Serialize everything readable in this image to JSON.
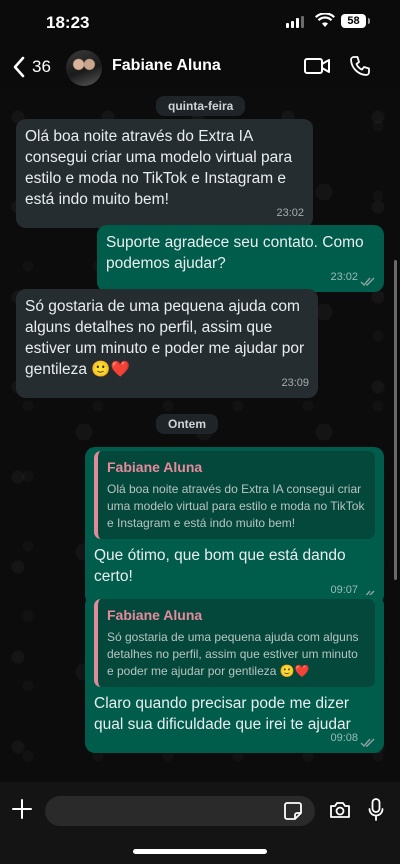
{
  "status_bar": {
    "time": "18:23",
    "battery": "58"
  },
  "header": {
    "back_count": "36",
    "contact_name": "Fabiane Aluna"
  },
  "day_separators": [
    "quinta-feira",
    "Ontem"
  ],
  "messages": [
    {
      "direction": "in",
      "text": "Olá boa noite através do Extra IA consegui criar uma modelo virtual para estilo e moda no TikTok e Instagram e está indo muito bem!",
      "time": "23:02"
    },
    {
      "direction": "out",
      "text": "Suporte agradece seu contato. Como podemos ajudar?",
      "time": "23:02"
    },
    {
      "direction": "in",
      "text": "Só gostaria de uma pequena ajuda com alguns detalhes no perfil, assim que estiver um minuto e poder me ajudar por gentileza 🙂❤️",
      "time": "23:09"
    },
    {
      "direction": "out",
      "quote_name": "Fabiane Aluna",
      "quote_text": "Olá boa noite através do Extra IA consegui criar uma modelo virtual para estilo e moda no TikTok e Instagram e está indo muito bem!",
      "text": "Que ótimo, que bom que está dando certo!",
      "time": "09:07"
    },
    {
      "direction": "out",
      "quote_name": "Fabiane Aluna",
      "quote_text": "Só gostaria de uma pequena ajuda com alguns detalhes no perfil, assim que estiver um minuto e poder me ajudar por gentileza 🙂❤️",
      "text": "Claro quando precisar pode me dizer qual sua dificuldade que irei te ajudar",
      "time": "09:08"
    }
  ],
  "icons": {
    "back": "chevron-left-icon",
    "video": "video-camera-icon",
    "phone": "phone-icon",
    "plus": "plus-icon",
    "sticker": "sticker-icon",
    "camera": "camera-icon",
    "mic": "microphone-icon",
    "read": "double-check-icon"
  },
  "colors": {
    "incoming": "#262d31",
    "outgoing": "#005c4b",
    "quote_name": "#e88a9c",
    "read_ticks": "#8fa3a0"
  }
}
